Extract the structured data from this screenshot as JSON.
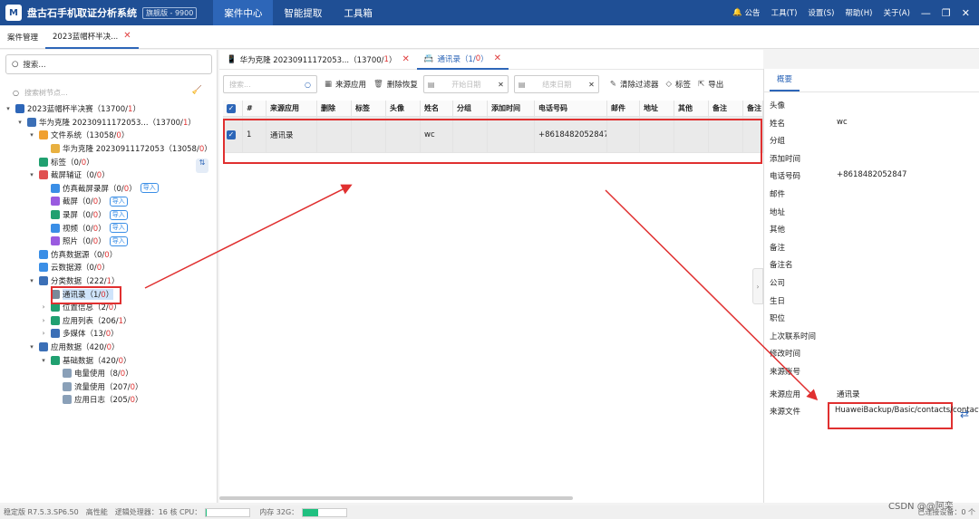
{
  "app": {
    "logo": "M",
    "title": "盘古石手机取证分析系统",
    "edition": "旗舰版 - 9900",
    "menus": [
      "案件中心",
      "智能提取",
      "工具箱"
    ],
    "right_menus": [
      "公告",
      "工具(T)",
      "设置(S)",
      "帮助(H)",
      "关于(A)"
    ]
  },
  "doc_tabs": [
    {
      "label": "案件管理"
    },
    {
      "label": "2023蓝帽杯半决..."
    }
  ],
  "left": {
    "search_placeholder": "搜索...",
    "node_search_placeholder": "搜索树节点...",
    "tree": [
      {
        "indent": 0,
        "arrow": "▾",
        "icon_color": "#2d66b8",
        "text": "2023蓝帽杯半决赛（13700/",
        "red": "1",
        "tail": "）"
      },
      {
        "indent": 1,
        "arrow": "▾",
        "icon_color": "#3b6fb6",
        "text": "华为克隆 20230911172053...（13700/",
        "red": "1",
        "tail": "）"
      },
      {
        "indent": 2,
        "arrow": "▾",
        "icon_color": "#f0a030",
        "text": "文件系统（13058/",
        "red": "0",
        "tail": "）"
      },
      {
        "indent": 3,
        "arrow": "",
        "icon_color": "#e8b040",
        "text": "华为克隆 20230911172053（13058/",
        "red": "0",
        "tail": "）"
      },
      {
        "indent": 2,
        "arrow": "",
        "icon_color": "#20a070",
        "text": "标签（0/",
        "red": "0",
        "tail": "）"
      },
      {
        "indent": 2,
        "arrow": "▾",
        "icon_color": "#e05050",
        "text": "截屏辅证（0/",
        "red": "0",
        "tail": "）"
      },
      {
        "indent": 3,
        "arrow": "",
        "icon_color": "#3a8ee6",
        "text": "仿真截屏录屏（0/",
        "red": "0",
        "tail": "）",
        "import": "导入"
      },
      {
        "indent": 3,
        "arrow": "",
        "icon_color": "#9a5be0",
        "text": "截屏（0/",
        "red": "0",
        "tail": "）",
        "import": "导入"
      },
      {
        "indent": 3,
        "arrow": "",
        "icon_color": "#20a070",
        "text": "录屏（0/",
        "red": "0",
        "tail": "）",
        "import": "导入"
      },
      {
        "indent": 3,
        "arrow": "",
        "icon_color": "#3a8ee6",
        "text": "视频（0/",
        "red": "0",
        "tail": "）",
        "import": "导入"
      },
      {
        "indent": 3,
        "arrow": "",
        "icon_color": "#9a5be0",
        "text": "照片（0/",
        "red": "0",
        "tail": "）",
        "import": "导入"
      },
      {
        "indent": 2,
        "arrow": "",
        "icon_color": "#3a8ee6",
        "text": "仿真数据源（0/",
        "red": "0",
        "tail": "）"
      },
      {
        "indent": 2,
        "arrow": "",
        "icon_color": "#3a8ee6",
        "text": "云数据源（0/",
        "red": "0",
        "tail": "）"
      },
      {
        "indent": 2,
        "arrow": "▾",
        "icon_color": "#3b6fb6",
        "text": "分类数据（222/",
        "red": "1",
        "tail": "）"
      },
      {
        "indent": 3,
        "arrow": "",
        "icon_color": "#7a8a99",
        "text": "通讯录（1/",
        "red": "0",
        "tail": "）",
        "selected": true
      },
      {
        "indent": 3,
        "arrow": "›",
        "icon_color": "#20a070",
        "text": "位置信息（2/",
        "red": "0",
        "tail": "）"
      },
      {
        "indent": 3,
        "arrow": "›",
        "icon_color": "#20a070",
        "text": "应用列表（206/",
        "red": "1",
        "tail": "）"
      },
      {
        "indent": 3,
        "arrow": "›",
        "icon_color": "#3b6fb6",
        "text": "多媒体（13/",
        "red": "0",
        "tail": "）"
      },
      {
        "indent": 2,
        "arrow": "▾",
        "icon_color": "#3b6fb6",
        "text": "应用数据（420/",
        "red": "0",
        "tail": "）"
      },
      {
        "indent": 3,
        "arrow": "▾",
        "icon_color": "#20a070",
        "text": "基础数据（420/",
        "red": "0",
        "tail": "）"
      },
      {
        "indent": 4,
        "arrow": "",
        "icon_color": "#8aa0b8",
        "text": "电量使用（8/",
        "red": "0",
        "tail": "）"
      },
      {
        "indent": 4,
        "arrow": "",
        "icon_color": "#8aa0b8",
        "text": "流量使用（207/",
        "red": "0",
        "tail": "）"
      },
      {
        "indent": 4,
        "arrow": "",
        "icon_color": "#8aa0b8",
        "text": "应用日志（205/",
        "red": "0",
        "tail": "）"
      }
    ]
  },
  "center": {
    "tabs": [
      {
        "label": "华为克隆 20230911172053...（13700/",
        "red": "1",
        "tail": "）"
      },
      {
        "label": "通讯录（1/",
        "red": "0",
        "tail": "）"
      }
    ],
    "search_placeholder": "搜索...",
    "buttons": {
      "source_app": "来源应用",
      "delete_restore": "删除恢复",
      "clear_filter": "清除过滤器",
      "tags": "标签",
      "export": "导出"
    },
    "start_date": "开始日期",
    "end_date": "结束日期",
    "columns": [
      "#",
      "来源应用",
      "删除",
      "标签",
      "头像",
      "姓名",
      "分组",
      "添加时间",
      "电话号码",
      "邮件",
      "地址",
      "其他",
      "备注",
      "备注"
    ],
    "rows": [
      [
        "1",
        "通讯录",
        "",
        "",
        "",
        "wc",
        "",
        "",
        "+8618482052847",
        "",
        "",
        "",
        "",
        ""
      ]
    ]
  },
  "right": {
    "tab": "概要",
    "fields": [
      {
        "label": "头像",
        "value": ""
      },
      {
        "label": "姓名",
        "value": "wc"
      },
      {
        "label": "分组",
        "value": ""
      },
      {
        "label": "添加时间",
        "value": ""
      },
      {
        "label": "电话号码",
        "value": "+8618482052847"
      },
      {
        "label": "邮件",
        "value": ""
      },
      {
        "label": "地址",
        "value": ""
      },
      {
        "label": "其他",
        "value": ""
      },
      {
        "label": "备注",
        "value": ""
      },
      {
        "label": "备注名",
        "value": ""
      },
      {
        "label": "公司",
        "value": ""
      },
      {
        "label": "生日",
        "value": ""
      },
      {
        "label": "职位",
        "value": ""
      },
      {
        "label": "上次联系时间",
        "value": ""
      },
      {
        "label": "修改时间",
        "value": ""
      },
      {
        "label": "来源账号",
        "value": ""
      }
    ],
    "source_app_label": "来源应用",
    "source_app_value": "通讯录",
    "source_file_label": "来源文件",
    "source_file_value": "HuaweiBackup/Basic/contacts/contacts.db"
  },
  "status": {
    "version": "稳定版 R7.5.3.SP6.50",
    "perf": "高性能",
    "cpu_label": "逻辑处理器：16 核  CPU：",
    "mem_label": "内存 32G：",
    "mem_percent": 35,
    "cpu_percent": 2,
    "connected": "已连接设备：0 个"
  },
  "watermark": "CSDN @@阿栾"
}
